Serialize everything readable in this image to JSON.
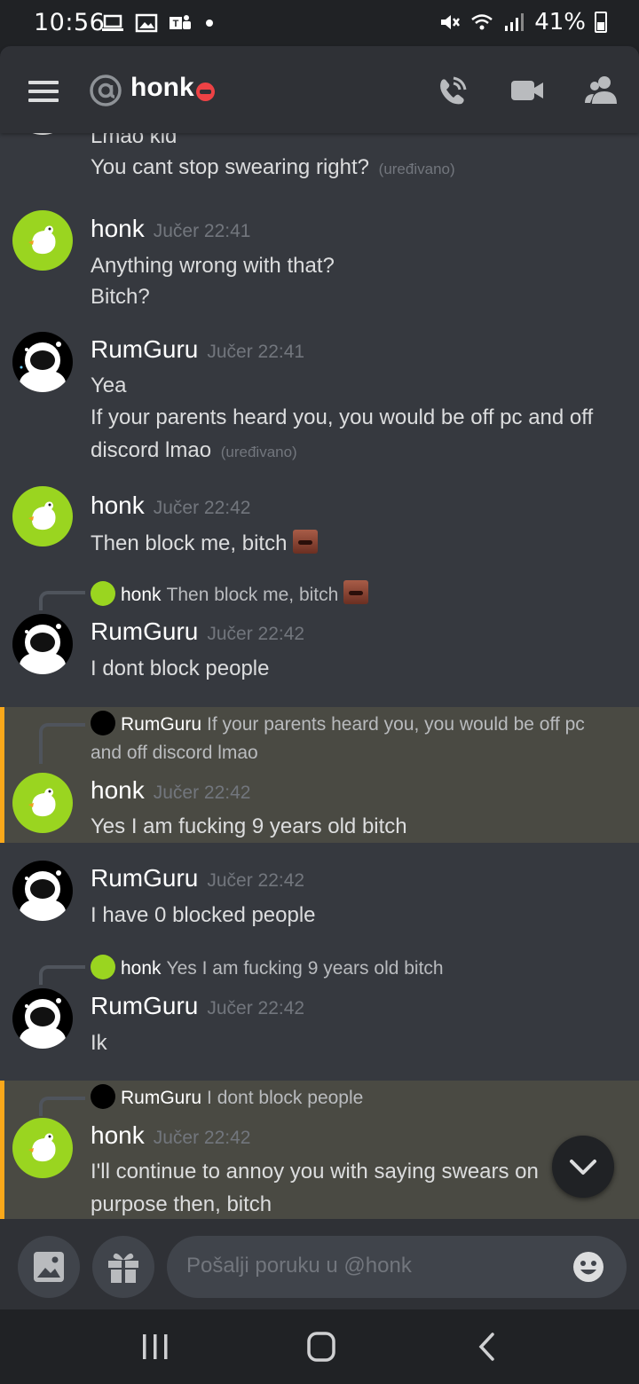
{
  "status_bar": {
    "time": "10:56",
    "battery": "41%",
    "left_icons": [
      "laptop-icon",
      "image-icon",
      "teams-icon",
      "dot"
    ],
    "right_icons": [
      "mute-icon",
      "wifi-icon",
      "signal-icon",
      "battery-icon"
    ]
  },
  "header": {
    "channel_name": "honk",
    "status": "dnd",
    "buttons": [
      "call-icon",
      "video-icon",
      "members-icon"
    ]
  },
  "colors": {
    "background": "#36393f",
    "header": "#2f3136",
    "highlight": "#4a4a43",
    "highlight_border": "#faa81a",
    "goose_avatar": "#9ad520",
    "dnd": "#ed4245"
  },
  "messages": [
    {
      "lines": [
        "Lmao kid",
        "You cant stop swearing right?"
      ],
      "edited_label": "(uređivano)"
    },
    {
      "author": "honk",
      "timestamp": "Jučer 22:41",
      "lines": [
        "Anything wrong with that?",
        "Bitch?"
      ]
    },
    {
      "author": "RumGuru",
      "timestamp": "Jučer 22:41",
      "lines": [
        "Yea",
        "If your parents heard you, you would be off pc and off",
        "discord lmao"
      ],
      "edited_label": "(uređivano)"
    },
    {
      "author": "honk",
      "timestamp": "Jučer 22:42",
      "lines": [
        "Then block me, bitch"
      ]
    },
    {
      "reply_author": "honk",
      "reply_text": "Then block me, bitch",
      "author": "RumGuru",
      "timestamp": "Jučer 22:42",
      "lines": [
        "I dont block people"
      ]
    },
    {
      "reply_author": "RumGuru",
      "reply_text": "If your parents heard you, you would be off pc",
      "reply_text_2": "and off discord lmao",
      "author": "honk",
      "timestamp": "Jučer 22:42",
      "lines": [
        "Yes I am fucking 9 years old bitch"
      ],
      "highlighted": true
    },
    {
      "author": "RumGuru",
      "timestamp": "Jučer 22:42",
      "lines": [
        "I have 0 blocked people"
      ]
    },
    {
      "reply_author": "honk",
      "reply_text": "Yes I am fucking 9 years old bitch",
      "author": "RumGuru",
      "timestamp": "Jučer 22:42",
      "lines": [
        "Ik"
      ]
    },
    {
      "reply_author": "RumGuru",
      "reply_text": "I dont block people",
      "author": "honk",
      "timestamp": "Jučer 22:42",
      "lines": [
        "I'll continue to annoy you with saying swears on",
        "purpose then, bitch"
      ],
      "highlighted": true
    }
  ],
  "composer": {
    "placeholder": "Pošalji poruku u @honk",
    "buttons": [
      "image-icon",
      "gift-icon",
      "emoji-icon"
    ]
  },
  "nav_bar": {
    "buttons": [
      "recents-icon",
      "home-icon",
      "back-icon"
    ]
  }
}
